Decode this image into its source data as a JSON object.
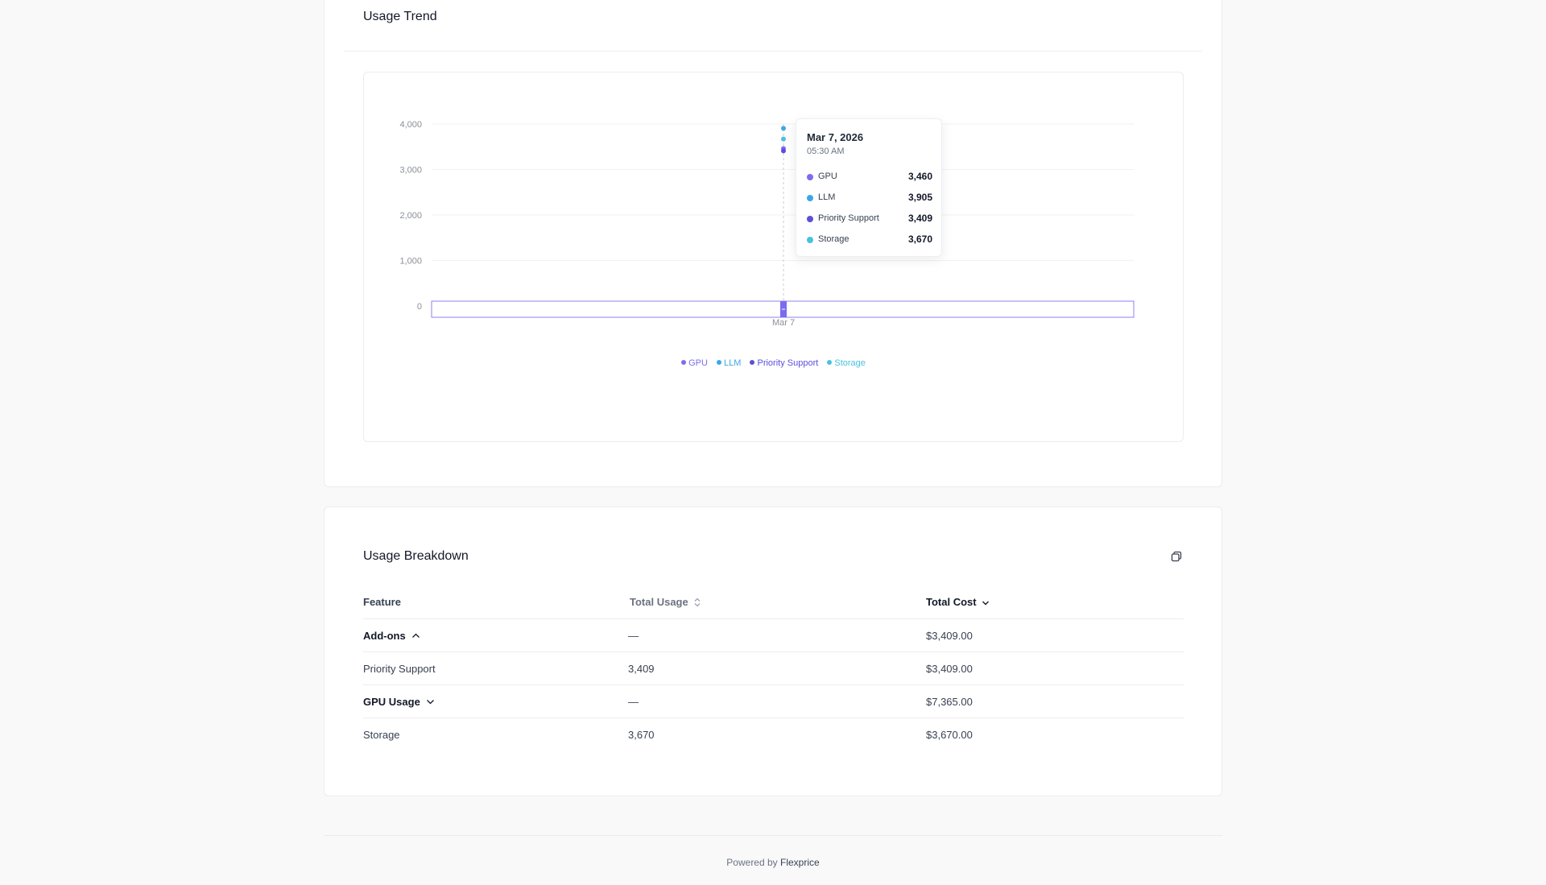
{
  "trend": {
    "title": "Usage Trend",
    "tooltip": {
      "date": "Mar 7, 2026",
      "time": "05:30 AM",
      "rows": [
        {
          "name": "GPU",
          "value": "3,460",
          "color": "#7b6cf0"
        },
        {
          "name": "LLM",
          "value": "3,905",
          "color": "#3ba7e6"
        },
        {
          "name": "Priority Support",
          "value": "3,409",
          "color": "#5b4fd9"
        },
        {
          "name": "Storage",
          "value": "3,670",
          "color": "#49c1df"
        }
      ]
    }
  },
  "chart_data": {
    "type": "scatter",
    "title": "",
    "xlabel": "",
    "ylabel": "",
    "x": [
      "Mar 7"
    ],
    "ylim": [
      0,
      4000
    ],
    "yticks": [
      "0",
      "1,000",
      "2,000",
      "3,000",
      "4,000"
    ],
    "grid": true,
    "legend_position": "bottom",
    "series": [
      {
        "name": "GPU",
        "values": [
          3460
        ],
        "color": "#7b6cf0"
      },
      {
        "name": "LLM",
        "values": [
          3905
        ],
        "color": "#3ba7e6"
      },
      {
        "name": "Priority Support",
        "values": [
          3409
        ],
        "color": "#5b4fd9"
      },
      {
        "name": "Storage",
        "values": [
          3670
        ],
        "color": "#49c1df"
      }
    ]
  },
  "breakdown": {
    "title": "Usage Breakdown",
    "copy_icon": "copy-icon",
    "columns": {
      "feature": "Feature",
      "usage": "Total Usage",
      "cost": "Total Cost"
    },
    "rows": [
      {
        "feature": "Add-ons",
        "usage": "—",
        "cost": "$3,409.00",
        "group": true,
        "expanded": true
      },
      {
        "feature": "Priority Support",
        "usage": "3,409",
        "cost": "$3,409.00",
        "group": false
      },
      {
        "feature": "GPU Usage",
        "usage": "—",
        "cost": "$7,365.00",
        "group": true,
        "expanded": false
      },
      {
        "feature": "Storage",
        "usage": "3,670",
        "cost": "$3,670.00",
        "group": false
      }
    ]
  },
  "footer": {
    "prefix": "Powered by",
    "brand": "Flexprice"
  }
}
